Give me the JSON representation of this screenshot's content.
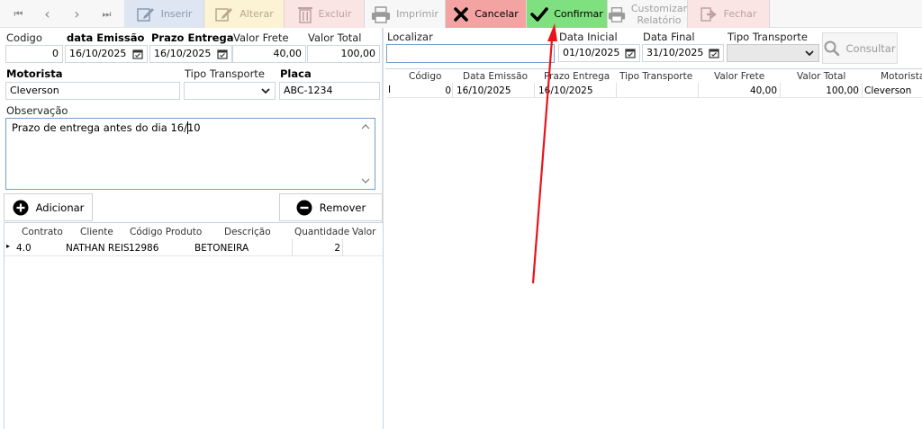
{
  "toolbar": {
    "nav_first": "⏮",
    "nav_prev": "‹",
    "nav_next": "›",
    "nav_last": "⏭",
    "inserir": "Inserir",
    "alterar": "Alterar",
    "excluir": "Excluir",
    "imprimir": "Imprimir",
    "cancelar": "Cancelar",
    "confirmar": "Confirmar",
    "customizar_line1": "Customizar",
    "customizar_line2": "Relatório",
    "fechar": "Fechar"
  },
  "form": {
    "codigo_label": "Codigo",
    "codigo_value": "0",
    "data_emissao_label": "data Emissão",
    "data_emissao_value": "16/10/2025",
    "prazo_label": "Prazo Entrega",
    "prazo_value": "16/10/2025",
    "valor_frete_label": "Valor Frete",
    "valor_frete_value": "40,00",
    "valor_total_label": "Valor Total",
    "valor_total_value": "100,00",
    "motorista_label": "Motorista",
    "motorista_value": "Cleverson",
    "tipo_transporte_label": "Tipo Transporte",
    "tipo_transporte_value": "",
    "placa_label": "Placa",
    "placa_value": "ABC-1234",
    "observacao_label": "Observação",
    "observacao_value": "Prazo de entrega antes do dia 16/10"
  },
  "items": {
    "add_label": "Adicionar",
    "remove_label": "Remover",
    "headers": [
      "Contrato",
      "Cliente",
      "Código Produto",
      "Descrição",
      "Quantidade",
      "Valor"
    ],
    "rows": [
      {
        "indicator": "▸",
        "contrato": "4.0",
        "cliente": "NATHAN REIS",
        "codigo": "12986",
        "descricao": "BETONEIRA",
        "quantidade": "2",
        "valor": ""
      }
    ]
  },
  "search": {
    "localizar_label": "Localizar",
    "localizar_value": "",
    "data_inicial_label": "Data Inicial",
    "data_inicial_value": "01/10/2025",
    "data_final_label": "Data Final",
    "data_final_value": "31/10/2025",
    "tipo_transporte_label": "Tipo Transporte",
    "tipo_transporte_value": "",
    "consultar_label": "Consultar"
  },
  "results": {
    "headers": [
      "Código",
      "Data Emissão",
      "Prazo Entrega",
      "Tipo Transporte",
      "Valor Frete",
      "Valor Total",
      "Motorista"
    ],
    "rows": [
      {
        "indicator": "I",
        "codigo": "0",
        "data_emissao": "16/10/2025",
        "prazo": "16/10/2025",
        "tipo": "",
        "frete": "40,00",
        "total": "100,00",
        "motorista": "Cleverson"
      }
    ]
  },
  "colors": {
    "cancel_bg": "#f4a3a3",
    "confirm_bg": "#7ee07e",
    "annotation_arrow": "#e8141c"
  }
}
